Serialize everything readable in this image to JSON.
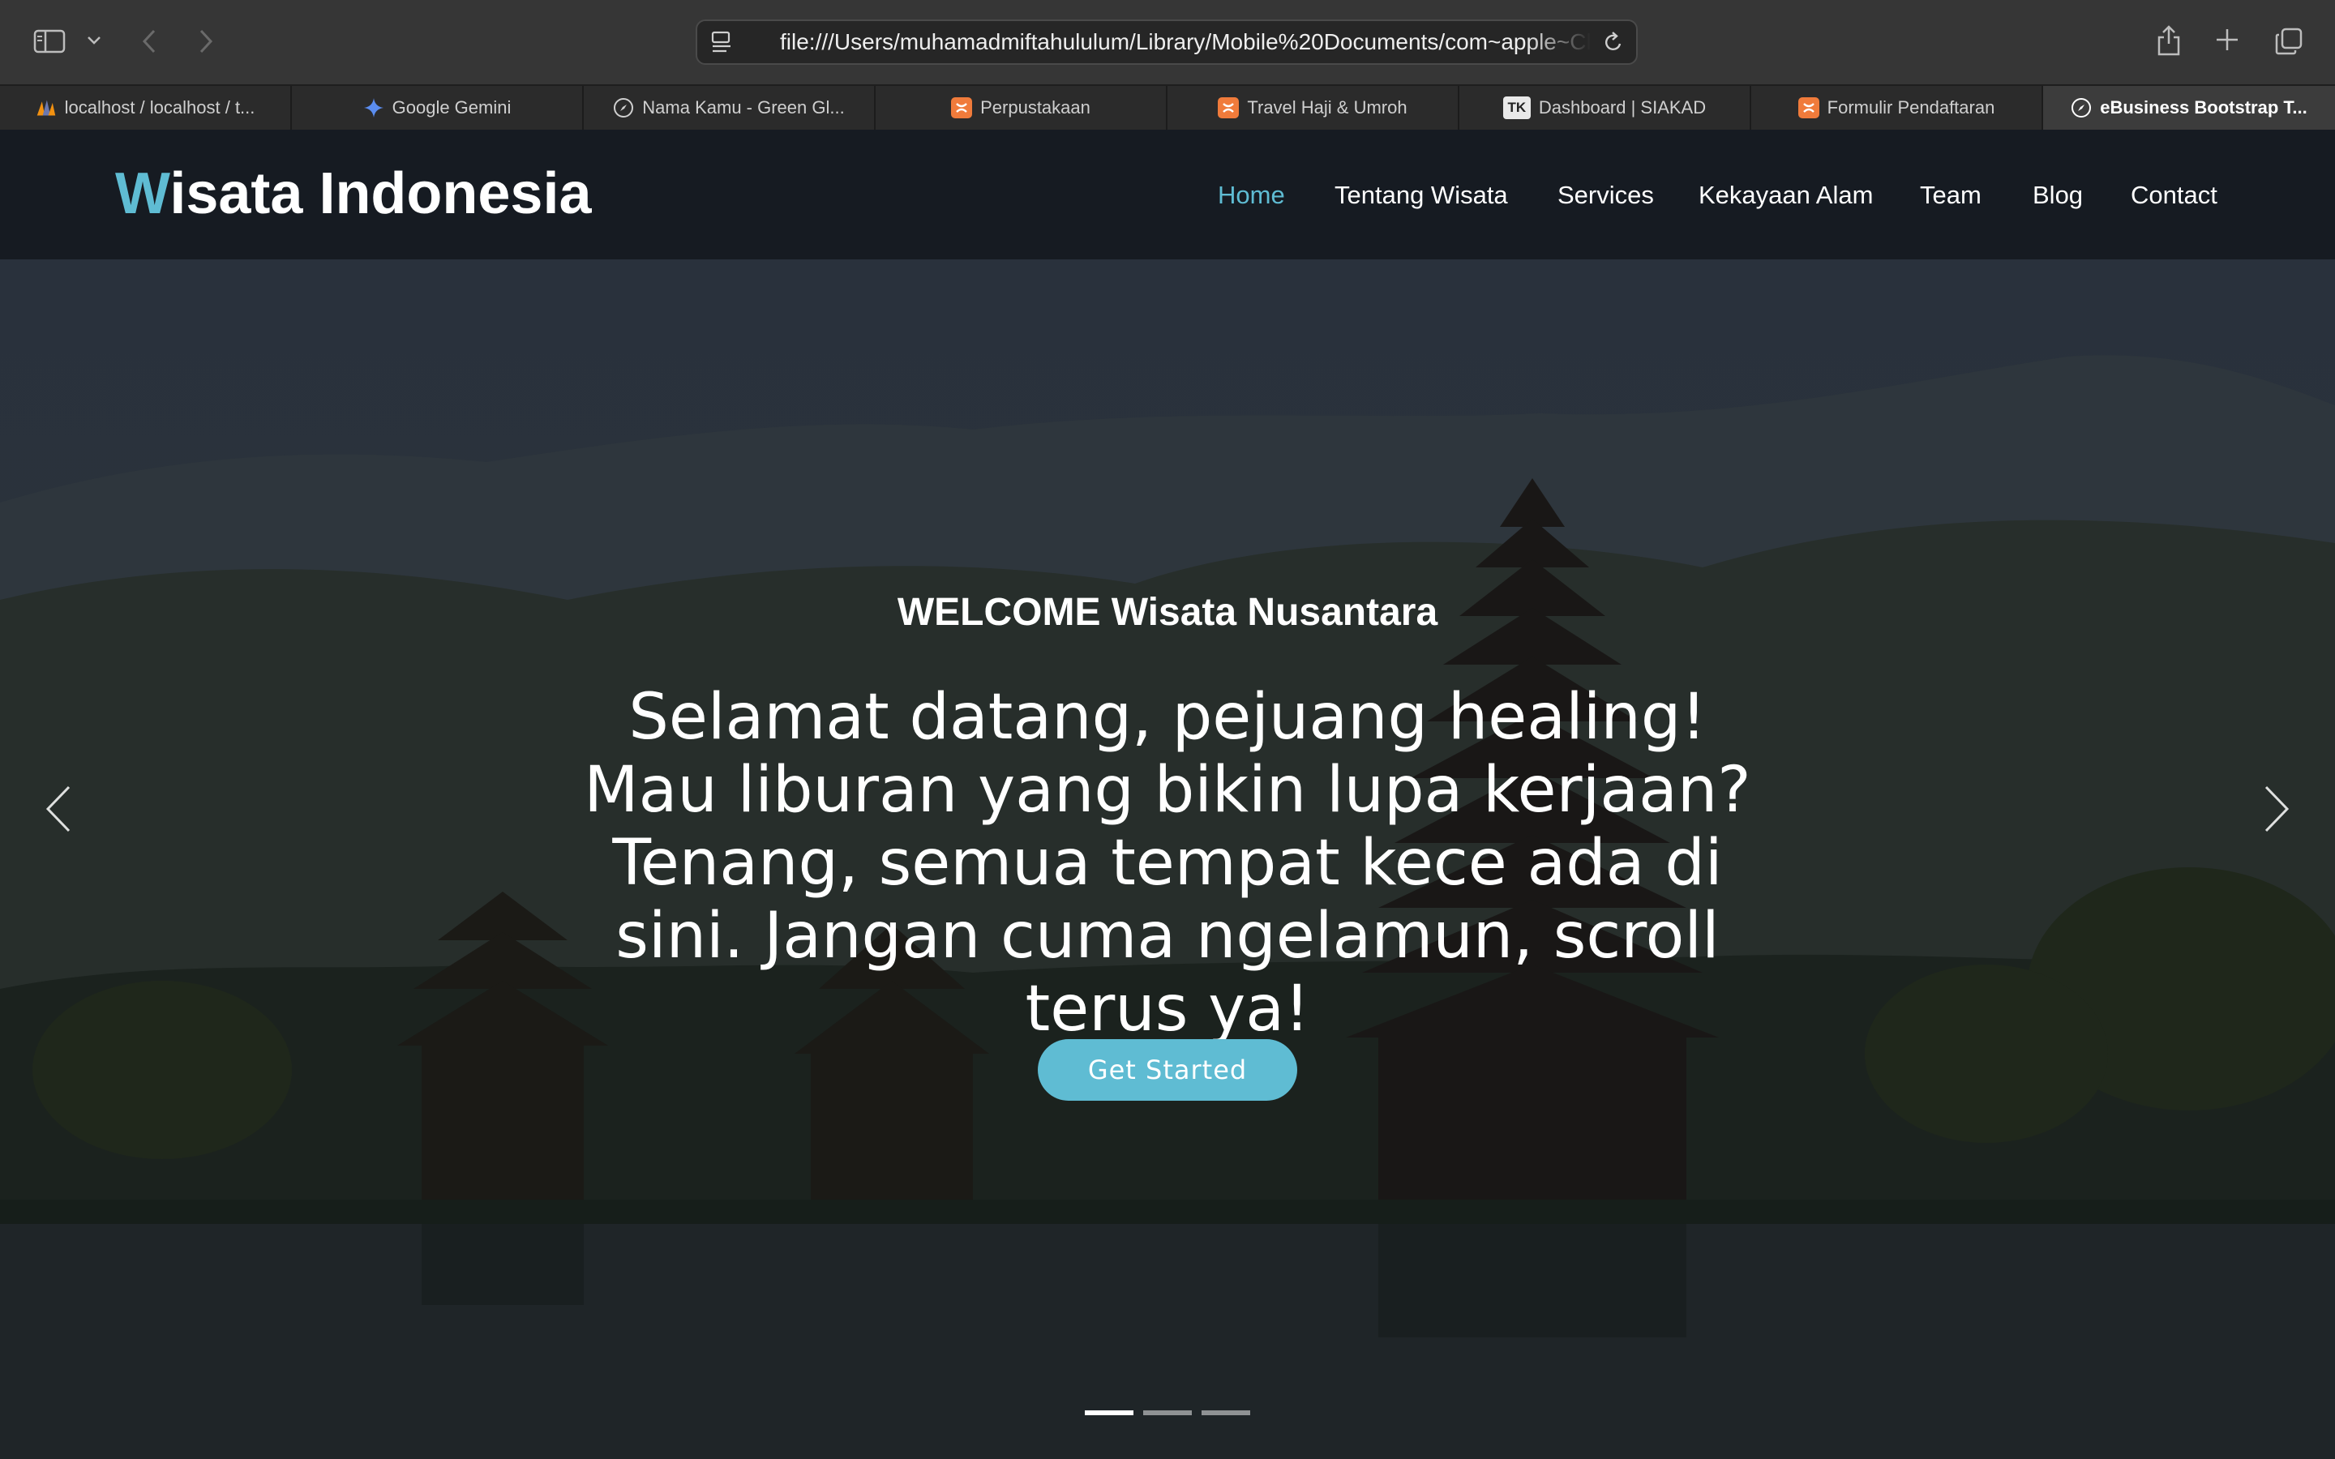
{
  "browser": {
    "url": "file:///Users/muhamadmiftahululum/Library/Mobile%20Documents/com~apple~CloudDocs/index.html",
    "tabs": [
      {
        "label": "localhost / localhost / t...",
        "icon": "phpmyadmin-icon"
      },
      {
        "label": "Google Gemini",
        "icon": "gemini-icon"
      },
      {
        "label": "Nama Kamu - Green Gl...",
        "icon": "compass-icon"
      },
      {
        "label": "Perpustakaan",
        "icon": "xampp-icon"
      },
      {
        "label": "Travel Haji & Umroh",
        "icon": "xampp-icon"
      },
      {
        "label": "Dashboard | SIAKAD",
        "icon": "tk-icon",
        "icon_text": "TK"
      },
      {
        "label": "Formulir Pendaftaran",
        "icon": "xampp-icon"
      },
      {
        "label": "eBusiness Bootstrap T...",
        "icon": "compass-icon",
        "active": true
      }
    ]
  },
  "site": {
    "logo_first": "W",
    "logo_rest": "isata Indonesia",
    "nav": [
      "Home",
      "Tentang Wisata",
      "Services",
      "Kekayaan Alam",
      "Team",
      "Blog",
      "Contact"
    ],
    "active_nav": "Home"
  },
  "hero": {
    "welcome": "WELCOME Wisata Nusantara",
    "text": "Selamat datang, pejuang healing! Mau liburan yang bikin lupa kerjaan? Tenang, semua tempat kece ada di sini. Jangan cuma ngelamun, scroll terus ya!",
    "cta": "Get Started",
    "slide_count": 3,
    "active_slide": 1
  },
  "colors": {
    "accent": "#5fbcd3",
    "header_bg": "#161b22",
    "toolbar_bg": "#363636"
  }
}
